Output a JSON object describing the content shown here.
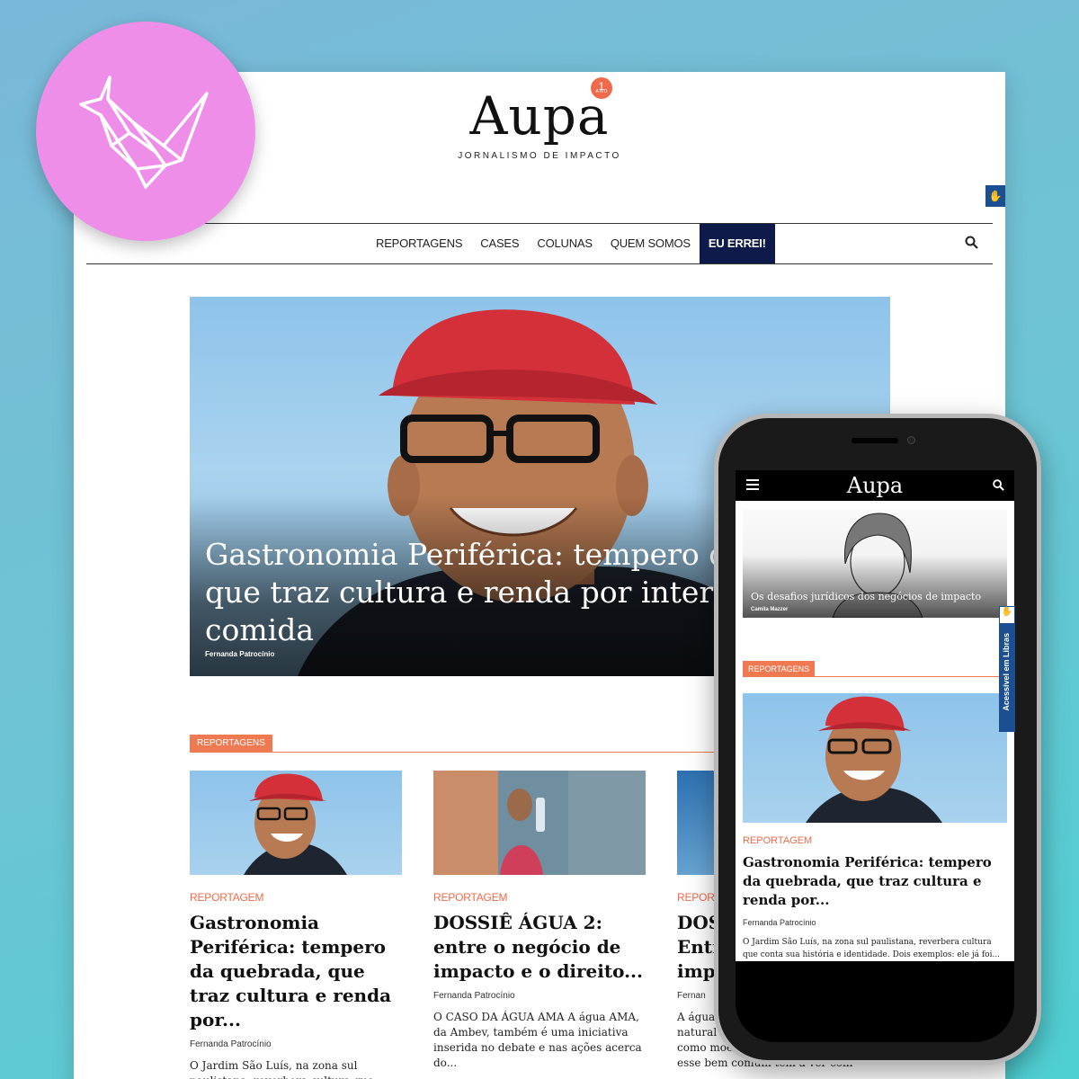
{
  "brand": {
    "name": "Aupa",
    "anniversary_number": "1",
    "anniversary_label": "ANO",
    "tagline": "JORNALISMO DE IMPACTO",
    "accent_color": "#ef7a52",
    "nav_special_color": "#0d1a4a",
    "libras_color": "#1b4f92",
    "badge_color": "#ee8ee8",
    "badge_icon": "origami-crane-icon"
  },
  "nav": {
    "items": [
      {
        "label": "REPORTAGENS"
      },
      {
        "label": "CASES"
      },
      {
        "label": "COLUNAS"
      },
      {
        "label": "QUEM SOMOS"
      },
      {
        "label": "EU ERREI!"
      }
    ],
    "search_icon": "search-icon"
  },
  "hero": {
    "title_lines": [
      "Gastronomia Periférica: tempero da",
      "que traz cultura e renda por interme",
      "comida"
    ],
    "author": "Fernanda Patrocínio"
  },
  "section": {
    "label": "REPORTAGENS"
  },
  "cards": [
    {
      "category": "REPORTAGEM",
      "title": "Gastronomia Periférica: tempero da quebrada, que traz cultura e renda por...",
      "author": "Fernanda Patrocínio",
      "excerpt": "O Jardim São Luís, na zona sul paulistana, reverbera cultura que conta sua história e identidade. Dois"
    },
    {
      "category": "REPORTAGEM",
      "title": "DOSSIÊ ÁGUA 2: entre o negócio de impacto e o direito...",
      "author": "Fernanda Patrocínio",
      "excerpt": "O CASO DA ÁGUA AMA A água AMA, da Ambev, também é uma iniciativa inserida no debate e nas ações acerca do..."
    },
    {
      "category": "REPORT",
      "title_lines": [
        "DOS",
        "Entr",
        "imp"
      ],
      "author": "Fernan",
      "excerpt_lines": [
        "A água",
        "natural",
        "como moed",
        "esse bem comum tem a ver com"
      ]
    }
  ],
  "mobile": {
    "logo": "Aupa",
    "menu_icon": "hamburger-menu-icon",
    "search_icon": "search-icon",
    "feature": {
      "title": "Os desafios jurídicos dos negócios de impacto",
      "author": "Camila Mazzer"
    },
    "section_label": "REPORTAGENS",
    "card": {
      "category": "REPORTAGEM",
      "title": "Gastronomia Periférica: tempero da quebrada, que traz cultura e renda por...",
      "author": "Fernanda Patrocínio",
      "excerpt": "O Jardim São Luís, na zona sul paulistana, reverbera cultura que conta sua história e identidade. Dois exemplos: ele já foi..."
    },
    "libras_label": "Acessível em Libras"
  }
}
